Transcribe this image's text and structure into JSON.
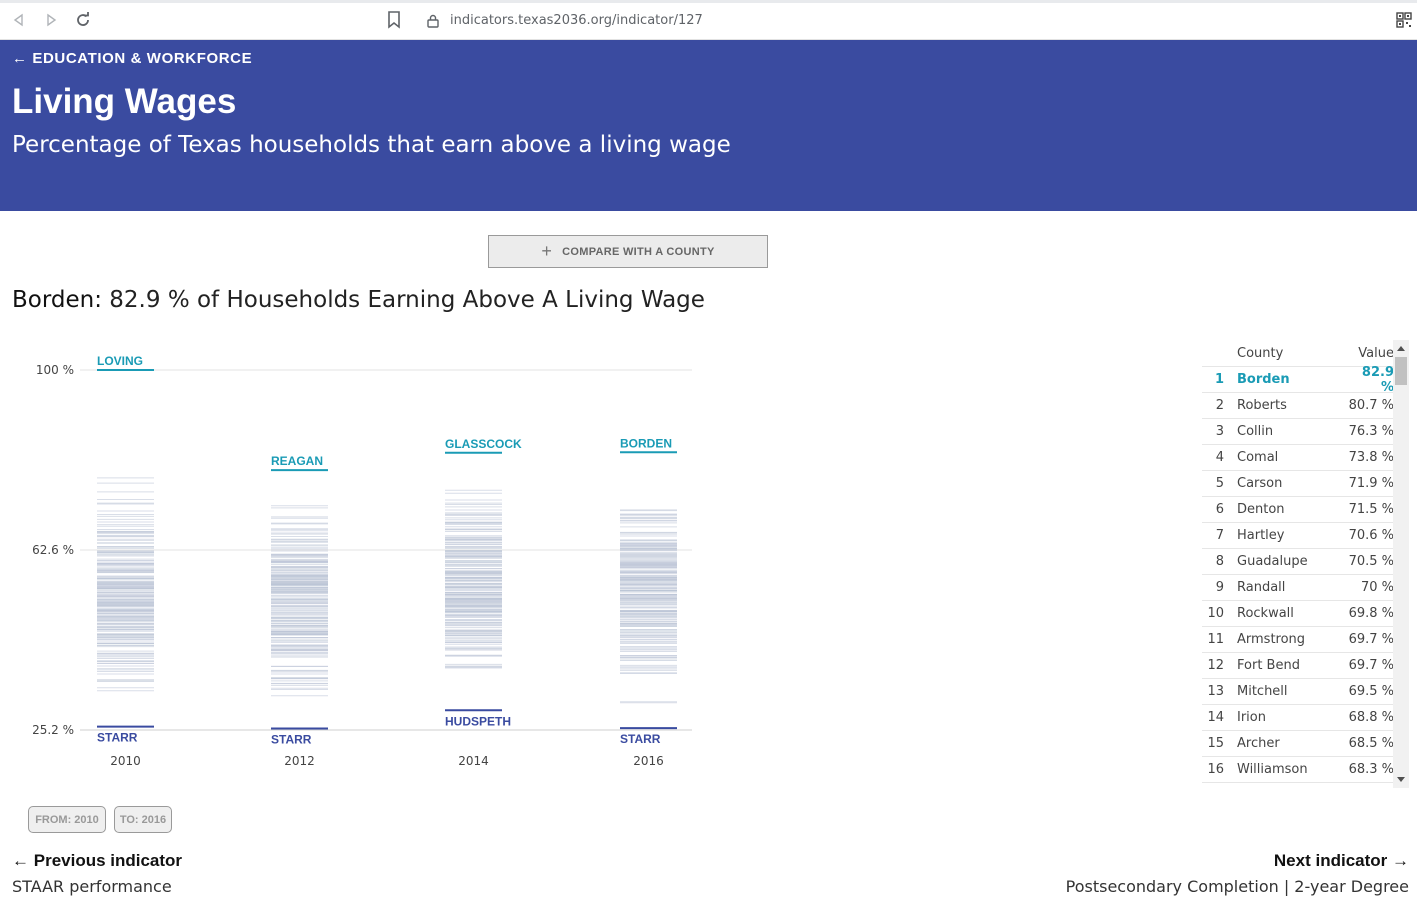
{
  "browser": {
    "url": "indicators.texas2036.org/indicator/127"
  },
  "header": {
    "breadcrumb_arrow": "←",
    "breadcrumb": "EDUCATION & WORKFORCE",
    "title": "Living Wages",
    "subtitle": "Percentage of Texas households that earn above a living wage"
  },
  "compare_button": {
    "icon": "+",
    "label": "COMPARE WITH A COUNTY"
  },
  "indicator_heading": {
    "county": "Borden:",
    "text": " 82.9 % of Households Earning Above A Living Wage"
  },
  "chart_data": {
    "type": "strip",
    "y_ticks": [
      {
        "value": 100,
        "label": "100 %"
      },
      {
        "value": 62.6,
        "label": "62.6 %"
      },
      {
        "value": 25.2,
        "label": "25.2 %"
      }
    ],
    "ylim": [
      25.2,
      100
    ],
    "grid": true,
    "columns": [
      {
        "year": "2010",
        "top": {
          "name": "LOVING",
          "value": 100
        },
        "bottom": {
          "name": "STARR",
          "value": 25.9
        }
      },
      {
        "year": "2012",
        "top": {
          "name": "REAGAN",
          "value": 79.2
        },
        "bottom": {
          "name": "STARR",
          "value": 25.5
        }
      },
      {
        "year": "2014",
        "top": {
          "name": "GLASSCOCK",
          "value": 82.8
        },
        "bottom": {
          "name": "HUDSPETH",
          "value": 29.3
        }
      },
      {
        "year": "2016",
        "top": {
          "name": "BORDEN",
          "value": 82.9
        },
        "bottom": {
          "name": "STARR",
          "value": 25.6
        }
      }
    ],
    "colors": {
      "top": "#1a9bb5",
      "bottom": "#3a4ba0",
      "strip": "#b9c3d6"
    }
  },
  "range": {
    "from": "FROM: 2010",
    "to": "TO: 2016"
  },
  "rank_table": {
    "headers": {
      "county": "County",
      "value": "Value"
    },
    "rows": [
      {
        "rank": "1",
        "county": "Borden",
        "value": "82.9 %"
      },
      {
        "rank": "2",
        "county": "Roberts",
        "value": "80.7 %"
      },
      {
        "rank": "3",
        "county": "Collin",
        "value": "76.3 %"
      },
      {
        "rank": "4",
        "county": "Comal",
        "value": "73.8 %"
      },
      {
        "rank": "5",
        "county": "Carson",
        "value": "71.9 %"
      },
      {
        "rank": "6",
        "county": "Denton",
        "value": "71.5 %"
      },
      {
        "rank": "7",
        "county": "Hartley",
        "value": "70.6 %"
      },
      {
        "rank": "8",
        "county": "Guadalupe",
        "value": "70.5 %"
      },
      {
        "rank": "9",
        "county": "Randall",
        "value": "70 %"
      },
      {
        "rank": "10",
        "county": "Rockwall",
        "value": "69.8 %"
      },
      {
        "rank": "11",
        "county": "Armstrong",
        "value": "69.7 %"
      },
      {
        "rank": "12",
        "county": "Fort Bend",
        "value": "69.7 %"
      },
      {
        "rank": "13",
        "county": "Mitchell",
        "value": "69.5 %"
      },
      {
        "rank": "14",
        "county": "Irion",
        "value": "68.8 %"
      },
      {
        "rank": "15",
        "county": "Archer",
        "value": "68.5 %"
      },
      {
        "rank": "16",
        "county": "Williamson",
        "value": "68.3 %"
      }
    ]
  },
  "footer": {
    "prev_arrow": "←",
    "prev_label": "Previous indicator",
    "prev_name": "STAAR performance",
    "next_label": "Next indicator",
    "next_arrow": "→",
    "next_name": "Postsecondary Completion | 2-year Degree"
  }
}
